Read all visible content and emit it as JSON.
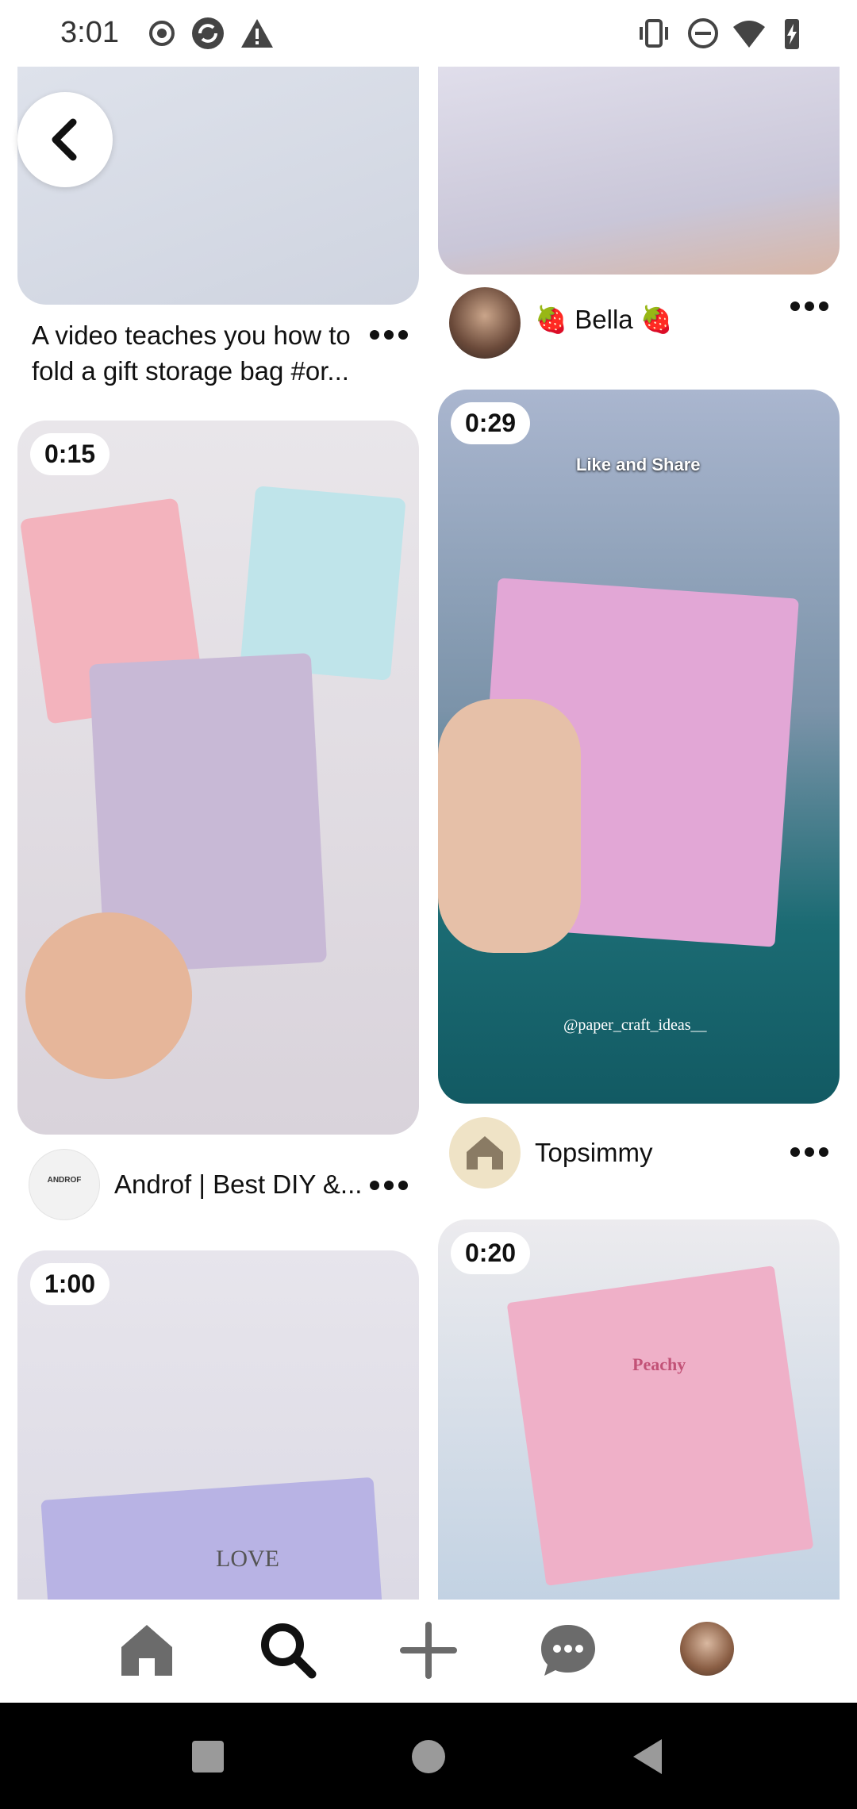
{
  "status_bar": {
    "time": "3:01",
    "left_icons": [
      "record-icon",
      "sync-icon",
      "warning-icon"
    ],
    "right_icons": [
      "vibrate-icon",
      "do-not-disturb-icon",
      "wifi-icon",
      "battery-charging-icon"
    ]
  },
  "feed": {
    "pins": [
      {
        "id": "gift-bag",
        "title": "A video teaches you how to fold a gift storage bag #or..."
      },
      {
        "id": "top-right",
        "creator": "🍓 Bella 🍓"
      },
      {
        "id": "bow-card",
        "duration": "0:15",
        "creator": "Androf | Best DIY &...",
        "creator_avatar_text": "ANDROF"
      },
      {
        "id": "drawer-box",
        "duration": "0:29",
        "overlay_text": "Like and Share",
        "watermark": "@paper_craft_ideas__",
        "creator": "Topsimmy"
      },
      {
        "id": "notebook",
        "duration": "1:00",
        "overlay_text": "LOVE"
      },
      {
        "id": "envelope",
        "duration": "0:20",
        "overlay_text": "Peachy"
      }
    ]
  },
  "bottom_nav": {
    "items": [
      {
        "icon": "home-icon",
        "active": false
      },
      {
        "icon": "search-icon",
        "active": true
      },
      {
        "icon": "plus-icon",
        "active": false
      },
      {
        "icon": "chat-icon",
        "active": false
      },
      {
        "icon": "profile-avatar",
        "active": false
      }
    ]
  },
  "system_nav": [
    "recents-button",
    "home-button",
    "back-button"
  ],
  "colors": {
    "text": "#111111",
    "nav_bar": "#000000",
    "background": "#ffffff"
  }
}
